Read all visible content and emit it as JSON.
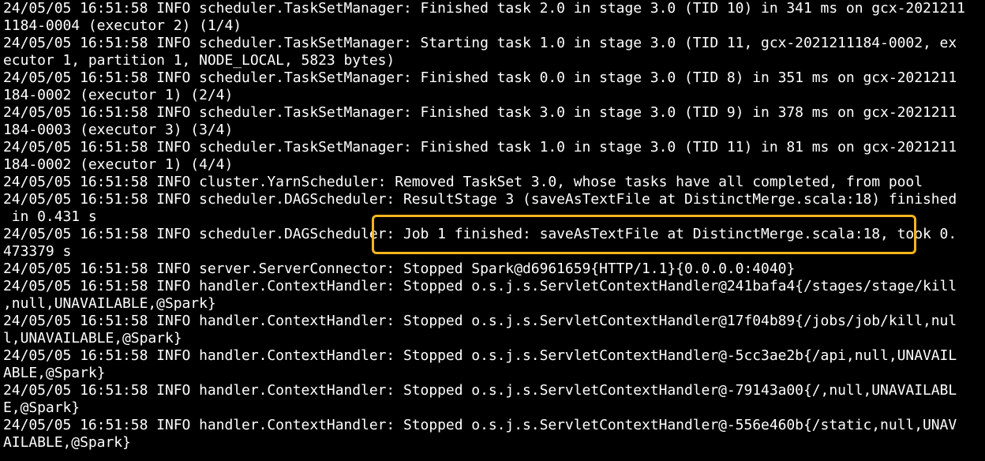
{
  "terminal": {
    "lines": [
      "24/05/05 16:51:58 INFO scheduler.TaskSetManager: Finished task 2.0 in stage 3.0 (TID 10) in 341 ms on gcx-2021211",
      "1184-0004 (executor 2) (1/4)",
      "24/05/05 16:51:58 INFO scheduler.TaskSetManager: Starting task 1.0 in stage 3.0 (TID 11, gcx-2021211184-0002, ex",
      "ecutor 1, partition 1, NODE_LOCAL, 5823 bytes)",
      "24/05/05 16:51:58 INFO scheduler.TaskSetManager: Finished task 0.0 in stage 3.0 (TID 8) in 351 ms on gcx-2021211",
      "184-0002 (executor 1) (2/4)",
      "24/05/05 16:51:58 INFO scheduler.TaskSetManager: Finished task 3.0 in stage 3.0 (TID 9) in 378 ms on gcx-2021211",
      "184-0003 (executor 3) (3/4)",
      "24/05/05 16:51:58 INFO scheduler.TaskSetManager: Finished task 1.0 in stage 3.0 (TID 11) in 81 ms on gcx-2021211",
      "184-0002 (executor 1) (4/4)",
      "24/05/05 16:51:58 INFO cluster.YarnScheduler: Removed TaskSet 3.0, whose tasks have all completed, from pool",
      "24/05/05 16:51:58 INFO scheduler.DAGScheduler: ResultStage 3 (saveAsTextFile at DistinctMerge.scala:18) finished",
      " in 0.431 s",
      "24/05/05 16:51:58 INFO scheduler.DAGScheduler: Job 1 finished: saveAsTextFile at DistinctMerge.scala:18, took 0.",
      "473379 s",
      "24/05/05 16:51:58 INFO server.ServerConnector: Stopped Spark@d6961659{HTTP/1.1}{0.0.0.0:4040}",
      "24/05/05 16:51:58 INFO handler.ContextHandler: Stopped o.s.j.s.ServletContextHandler@241bafa4{/stages/stage/kill",
      ",null,UNAVAILABLE,@Spark}",
      "24/05/05 16:51:58 INFO handler.ContextHandler: Stopped o.s.j.s.ServletContextHandler@17f04b89{/jobs/job/kill,nul",
      "l,UNAVAILABLE,@Spark}",
      "24/05/05 16:51:58 INFO handler.ContextHandler: Stopped o.s.j.s.ServletContextHandler@-5cc3ae2b{/api,null,UNAVAIL",
      "ABLE,@Spark}",
      "24/05/05 16:51:58 INFO handler.ContextHandler: Stopped o.s.j.s.ServletContextHandler@-79143a00{/,null,UNAVAILABL",
      "E,@Spark}",
      "24/05/05 16:51:58 INFO handler.ContextHandler: Stopped o.s.j.s.ServletContextHandler@-556e460b{/static,null,UNAV",
      "AILABLE,@Spark}"
    ]
  },
  "highlight": {
    "color": "#f5b51c"
  },
  "colors": {
    "background": "#000000",
    "text": "#ffffff"
  }
}
